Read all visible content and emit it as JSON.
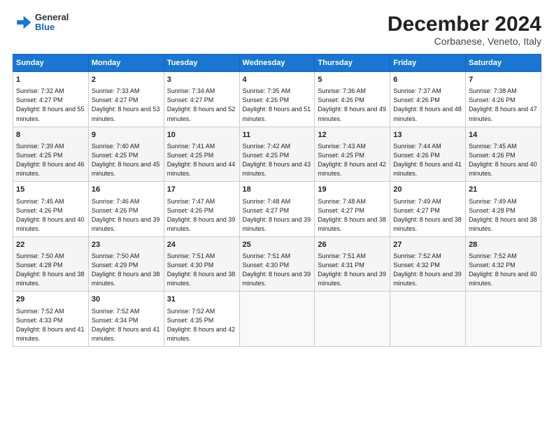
{
  "logo": {
    "line1": "General",
    "line2": "Blue"
  },
  "title": "December 2024",
  "subtitle": "Corbanese, Veneto, Italy",
  "days_header": [
    "Sunday",
    "Monday",
    "Tuesday",
    "Wednesday",
    "Thursday",
    "Friday",
    "Saturday"
  ],
  "weeks": [
    [
      {
        "day": "1",
        "sunrise": "7:32 AM",
        "sunset": "4:27 PM",
        "daylight": "8 hours and 55 minutes."
      },
      {
        "day": "2",
        "sunrise": "7:33 AM",
        "sunset": "4:27 PM",
        "daylight": "8 hours and 53 minutes."
      },
      {
        "day": "3",
        "sunrise": "7:34 AM",
        "sunset": "4:27 PM",
        "daylight": "8 hours and 52 minutes."
      },
      {
        "day": "4",
        "sunrise": "7:35 AM",
        "sunset": "4:26 PM",
        "daylight": "8 hours and 51 minutes."
      },
      {
        "day": "5",
        "sunrise": "7:36 AM",
        "sunset": "4:26 PM",
        "daylight": "8 hours and 49 minutes."
      },
      {
        "day": "6",
        "sunrise": "7:37 AM",
        "sunset": "4:26 PM",
        "daylight": "8 hours and 48 minutes."
      },
      {
        "day": "7",
        "sunrise": "7:38 AM",
        "sunset": "4:26 PM",
        "daylight": "8 hours and 47 minutes."
      }
    ],
    [
      {
        "day": "8",
        "sunrise": "7:39 AM",
        "sunset": "4:25 PM",
        "daylight": "8 hours and 46 minutes."
      },
      {
        "day": "9",
        "sunrise": "7:40 AM",
        "sunset": "4:25 PM",
        "daylight": "8 hours and 45 minutes."
      },
      {
        "day": "10",
        "sunrise": "7:41 AM",
        "sunset": "4:25 PM",
        "daylight": "8 hours and 44 minutes."
      },
      {
        "day": "11",
        "sunrise": "7:42 AM",
        "sunset": "4:25 PM",
        "daylight": "8 hours and 43 minutes."
      },
      {
        "day": "12",
        "sunrise": "7:43 AM",
        "sunset": "4:25 PM",
        "daylight": "8 hours and 42 minutes."
      },
      {
        "day": "13",
        "sunrise": "7:44 AM",
        "sunset": "4:26 PM",
        "daylight": "8 hours and 41 minutes."
      },
      {
        "day": "14",
        "sunrise": "7:45 AM",
        "sunset": "4:26 PM",
        "daylight": "8 hours and 40 minutes."
      }
    ],
    [
      {
        "day": "15",
        "sunrise": "7:45 AM",
        "sunset": "4:26 PM",
        "daylight": "8 hours and 40 minutes."
      },
      {
        "day": "16",
        "sunrise": "7:46 AM",
        "sunset": "4:26 PM",
        "daylight": "8 hours and 39 minutes."
      },
      {
        "day": "17",
        "sunrise": "7:47 AM",
        "sunset": "4:26 PM",
        "daylight": "8 hours and 39 minutes."
      },
      {
        "day": "18",
        "sunrise": "7:48 AM",
        "sunset": "4:27 PM",
        "daylight": "8 hours and 39 minutes."
      },
      {
        "day": "19",
        "sunrise": "7:48 AM",
        "sunset": "4:27 PM",
        "daylight": "8 hours and 38 minutes."
      },
      {
        "day": "20",
        "sunrise": "7:49 AM",
        "sunset": "4:27 PM",
        "daylight": "8 hours and 38 minutes."
      },
      {
        "day": "21",
        "sunrise": "7:49 AM",
        "sunset": "4:28 PM",
        "daylight": "8 hours and 38 minutes."
      }
    ],
    [
      {
        "day": "22",
        "sunrise": "7:50 AM",
        "sunset": "4:28 PM",
        "daylight": "8 hours and 38 minutes."
      },
      {
        "day": "23",
        "sunrise": "7:50 AM",
        "sunset": "4:29 PM",
        "daylight": "8 hours and 38 minutes."
      },
      {
        "day": "24",
        "sunrise": "7:51 AM",
        "sunset": "4:30 PM",
        "daylight": "8 hours and 38 minutes."
      },
      {
        "day": "25",
        "sunrise": "7:51 AM",
        "sunset": "4:30 PM",
        "daylight": "8 hours and 39 minutes."
      },
      {
        "day": "26",
        "sunrise": "7:51 AM",
        "sunset": "4:31 PM",
        "daylight": "8 hours and 39 minutes."
      },
      {
        "day": "27",
        "sunrise": "7:52 AM",
        "sunset": "4:32 PM",
        "daylight": "8 hours and 39 minutes."
      },
      {
        "day": "28",
        "sunrise": "7:52 AM",
        "sunset": "4:32 PM",
        "daylight": "8 hours and 40 minutes."
      }
    ],
    [
      {
        "day": "29",
        "sunrise": "7:52 AM",
        "sunset": "4:33 PM",
        "daylight": "8 hours and 41 minutes."
      },
      {
        "day": "30",
        "sunrise": "7:52 AM",
        "sunset": "4:34 PM",
        "daylight": "8 hours and 41 minutes."
      },
      {
        "day": "31",
        "sunrise": "7:52 AM",
        "sunset": "4:35 PM",
        "daylight": "8 hours and 42 minutes."
      },
      null,
      null,
      null,
      null
    ]
  ],
  "labels": {
    "sunrise": "Sunrise: ",
    "sunset": "Sunset: ",
    "daylight": "Daylight: "
  }
}
